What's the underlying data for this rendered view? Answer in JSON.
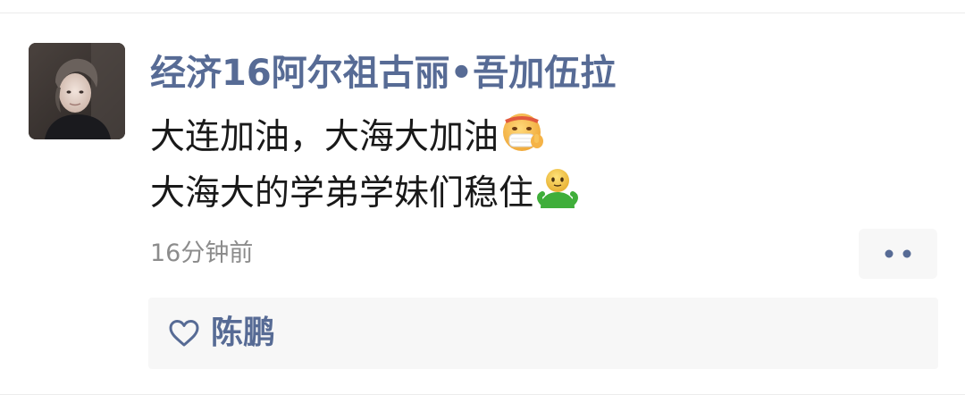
{
  "post": {
    "author_name": "经济16阿尔祖古丽•吾加伍拉",
    "line1_text": "大连加油，大海大加油",
    "line1_emoji": "mask-face-emoji",
    "line2_text": "大海大的学弟学妹们稳住",
    "line2_emoji": "green-figure-emoji",
    "timestamp": "16分钟前",
    "more_icon": "more-dots-icon"
  },
  "likes": {
    "icon": "heart-icon",
    "names": "陈鹏"
  },
  "colors": {
    "name_link": "#576b95",
    "body_text": "#191919",
    "timestamp": "#8c8c8c",
    "panel_bg": "#f7f7f7"
  }
}
